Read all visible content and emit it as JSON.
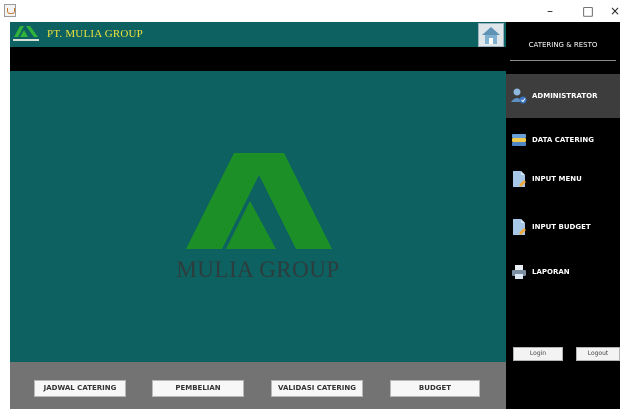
{
  "window": {
    "minimize_glyph": "–",
    "maximize_glyph": "□",
    "close_glyph": "×"
  },
  "header": {
    "company_name": "PT. MULIA GROUP"
  },
  "main": {
    "brand_text": "MULIA GROUP"
  },
  "bottom_buttons": [
    {
      "label": "JADWAL CATERING"
    },
    {
      "label": "PEMBELIAN"
    },
    {
      "label": "VALIDASI CATERING"
    },
    {
      "label": "BUDGET"
    }
  ],
  "sidebar": {
    "title": "CATERING & RESTO",
    "items": [
      {
        "label": "ADMINISTRATOR",
        "icon": "admin-icon"
      },
      {
        "label": "DATA CATERING",
        "icon": "database-icon"
      },
      {
        "label": "INPUT MENU",
        "icon": "document-icon"
      },
      {
        "label": "INPUT BUDGET",
        "icon": "document-icon"
      },
      {
        "label": "LAPORAN",
        "icon": "printer-icon"
      }
    ],
    "login_label": "Login",
    "logout_label": "Logout"
  },
  "colors": {
    "teal": "#0d6160",
    "logo_green": "#1c8f27",
    "company_yellow": "#f0e43a"
  }
}
